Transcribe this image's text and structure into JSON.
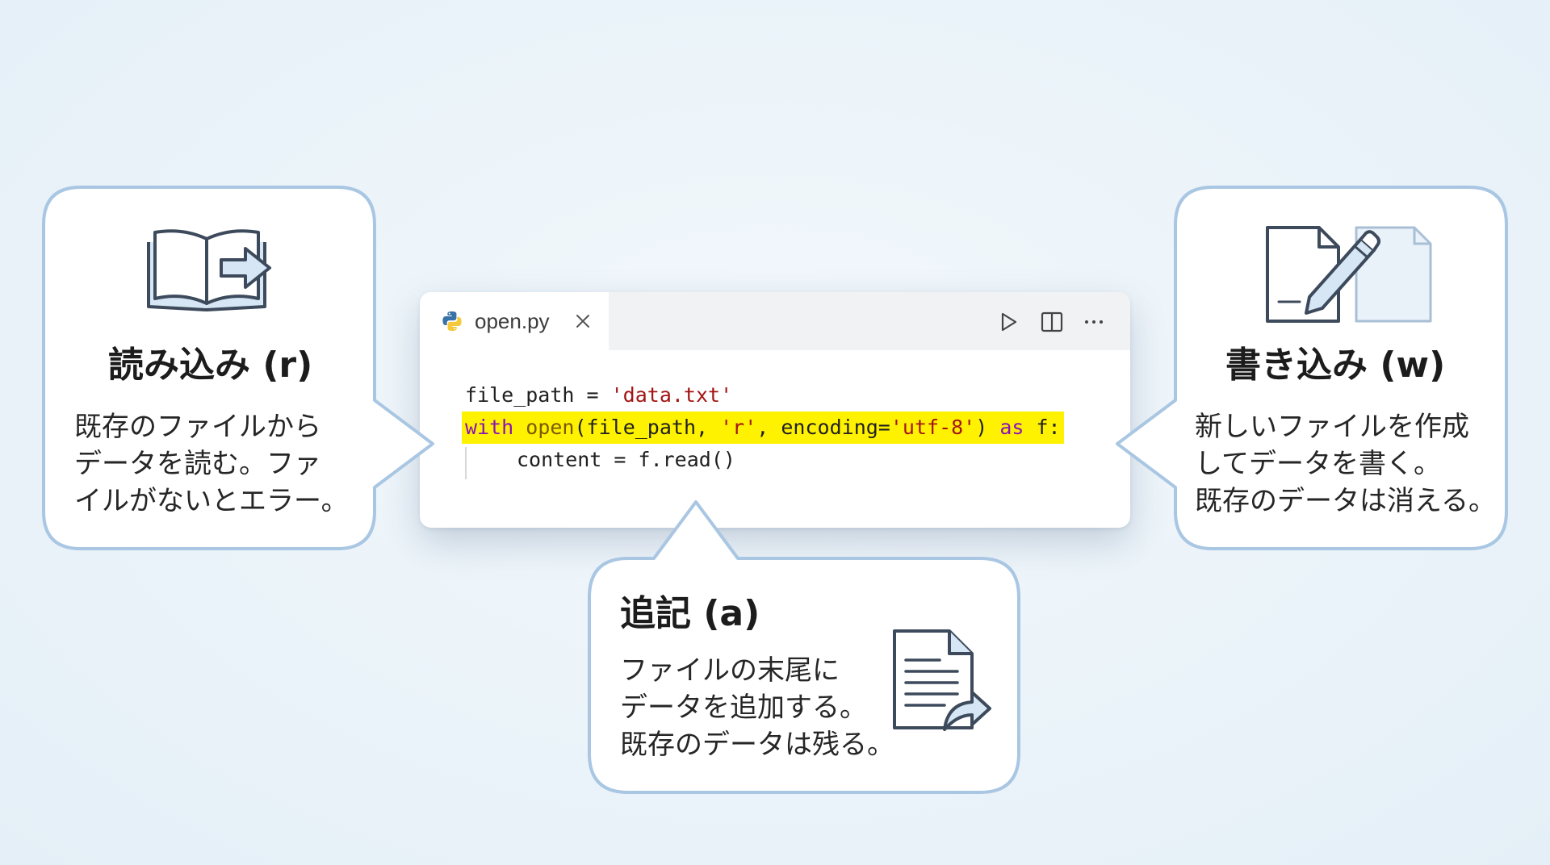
{
  "editor": {
    "tab": {
      "filename": "open.py",
      "file_icon": "python-icon",
      "close_icon": "close-icon"
    },
    "toolbar": {
      "run_icon": "run-icon",
      "split_icon": "split-editor-icon",
      "more_icon": "more-icon"
    },
    "code": {
      "line1": {
        "var": "file_path",
        "eq": " = ",
        "str": "'data.txt'"
      },
      "line2": {
        "kw_with": "with",
        "sp1": " ",
        "fn_open": "open",
        "args_a": "(file_path, ",
        "mode": "'r'",
        "args_b": ", encoding=",
        "enc": "'utf-8'",
        "args_c": ") ",
        "kw_as": "as",
        "tail": " f:"
      },
      "line3": "content = f.read()",
      "highlight_color": "#fff200"
    }
  },
  "callouts": {
    "read": {
      "icon": "open-book-arrow-icon",
      "title": "読み込み (r)",
      "lines": [
        "既存のファイルから",
        "データを読む。ファ",
        "イルがないとエラー。"
      ]
    },
    "write": {
      "icon": "document-pencil-icon",
      "title": "書き込み (w)",
      "lines": [
        "新しいファイルを作成",
        "してデータを書く。",
        "既存のデータは消える。"
      ]
    },
    "append": {
      "icon": "document-append-icon",
      "title": "追記 (a)",
      "lines": [
        "ファイルの末尾に",
        "データを追加する。",
        "既存のデータは残る。"
      ]
    }
  },
  "colors": {
    "bubble_border": "#a9c6e2",
    "icon_stroke": "#3d4a5c",
    "icon_fill": "#d6e6f5"
  }
}
